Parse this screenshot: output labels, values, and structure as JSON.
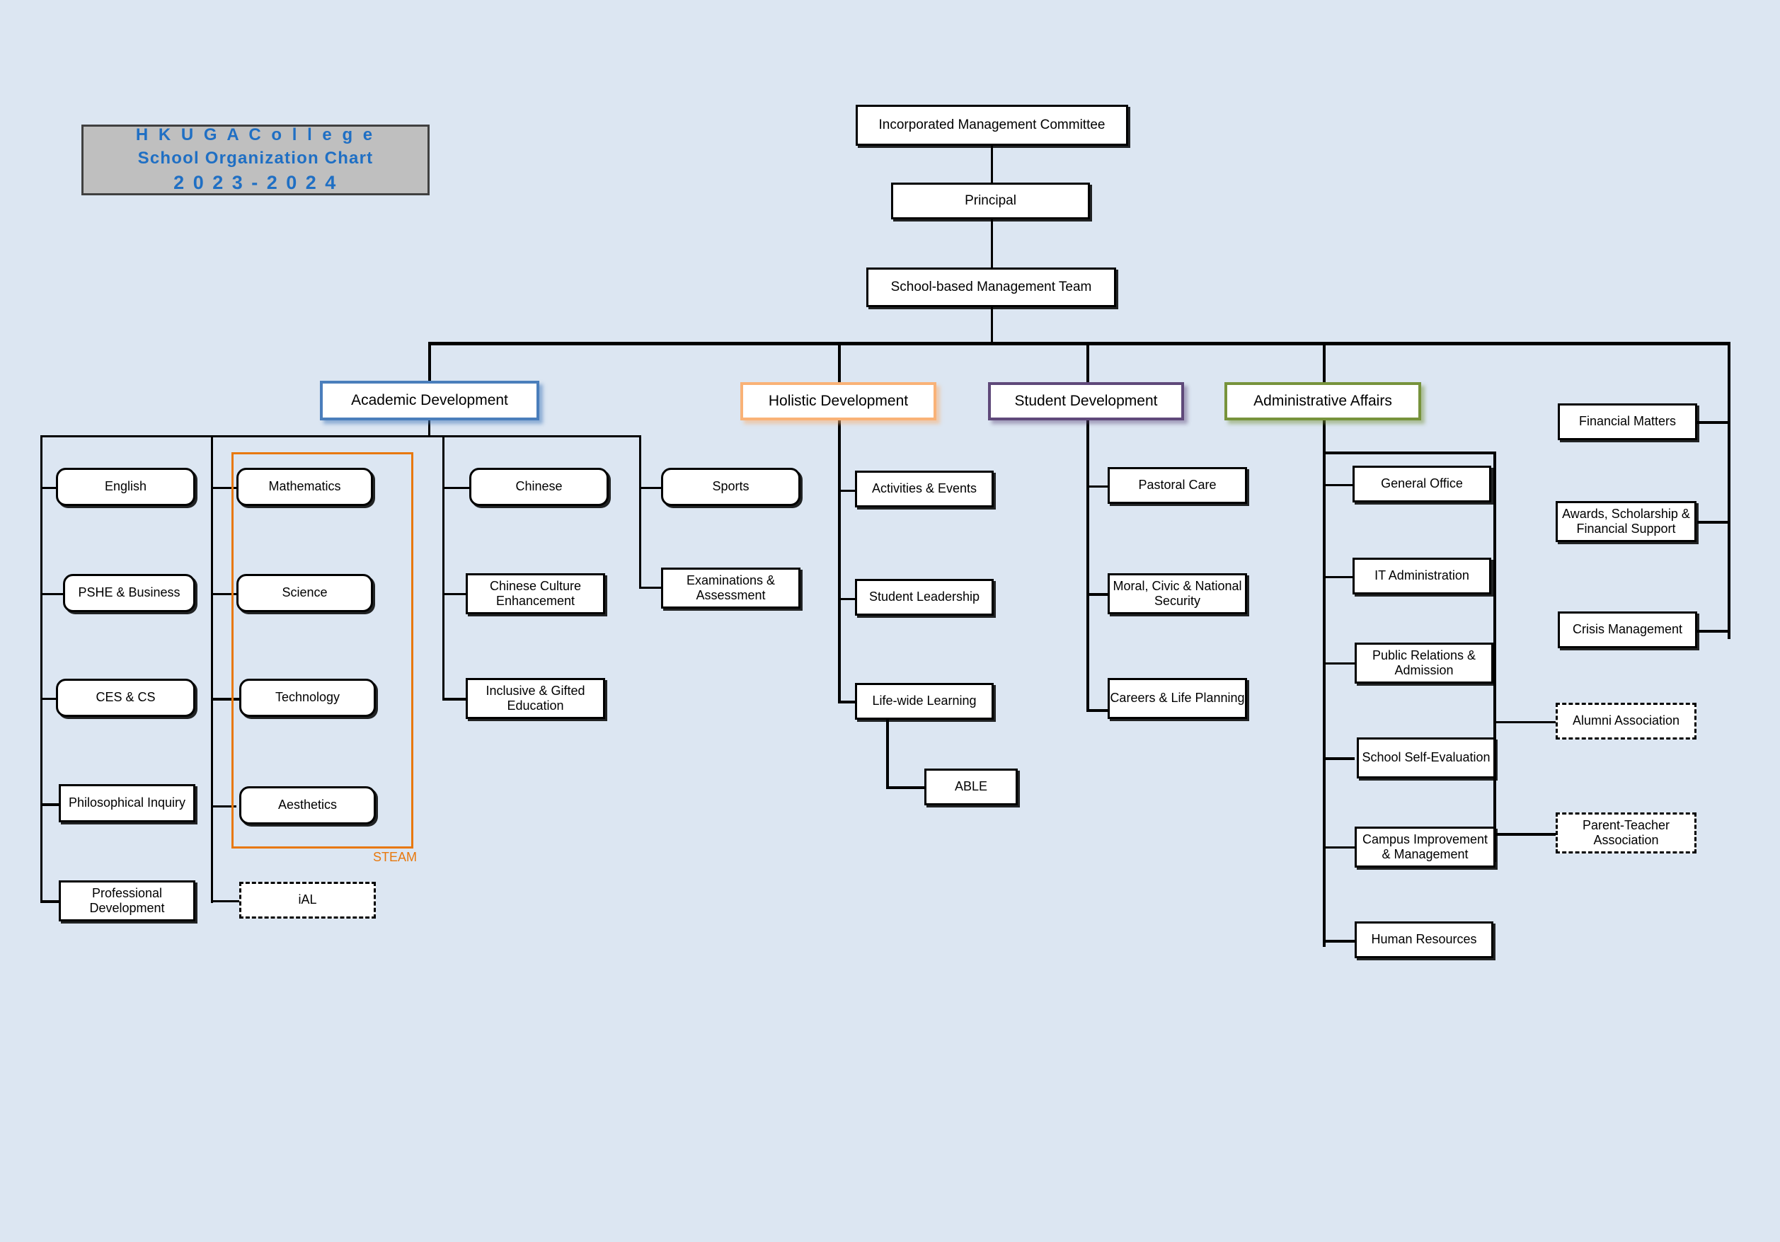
{
  "title": {
    "line1": "H K U G A  C o l l e g e",
    "line2": "School Organization Chart",
    "line3": "2 0 2 3 - 2 0 2 4"
  },
  "top": {
    "imc": "Incorporated Management Committee",
    "principal": "Principal",
    "sbmt": "School-based Management Team"
  },
  "headers": {
    "academic": "Academic Development",
    "holistic": "Holistic Development",
    "student": "Student Development",
    "admin": "Administrative Affairs"
  },
  "academic": {
    "col1": [
      "English",
      "PSHE & Business",
      "CES & CS",
      "Philosophical Inquiry",
      "Professional Development"
    ],
    "col2": [
      "Mathematics",
      "Science",
      "Technology",
      "Aesthetics"
    ],
    "steam_label": "STEAM",
    "ial": "iAL",
    "col3": [
      "Chinese",
      "Chinese Culture Enhancement",
      "Inclusive & Gifted Education"
    ],
    "col4": [
      "Sports",
      "Examinations & Assessment"
    ]
  },
  "holistic": {
    "items": [
      "Activities & Events",
      "Student Leadership",
      "Life-wide Learning"
    ],
    "able": "ABLE"
  },
  "student": {
    "items": [
      "Pastoral Care",
      "Moral, Civic & National Security",
      "Careers & Life Planning"
    ]
  },
  "admin": {
    "items": [
      "General Office",
      "IT Administration",
      "Public Relations & Admission",
      "School Self-Evaluation",
      "Campus Improvement & Management",
      "Human Resources"
    ]
  },
  "right": {
    "solid": [
      "Financial Matters",
      "Awards, Scholarship & Financial Support",
      "Crisis Management"
    ],
    "dashed": [
      "Alumni Association",
      "Parent-Teacher Association"
    ]
  },
  "colors": {
    "background": "#dce6f2",
    "title_text": "#1f6fc4",
    "title_fill": "#bfbfbf",
    "academic_border": "#4a7ebb",
    "holistic_border": "#f9b277",
    "student_border": "#5f497a",
    "admin_border": "#77933c",
    "steam_border": "#e8780c"
  }
}
